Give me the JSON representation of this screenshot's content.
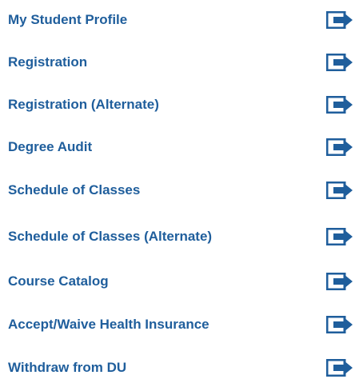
{
  "menu": {
    "items": [
      {
        "label": "My Student Profile",
        "icon": "external-link-icon"
      },
      {
        "label": "Registration",
        "icon": "external-link-icon"
      },
      {
        "label": "Registration (Alternate)",
        "icon": "external-link-icon"
      },
      {
        "label": "Degree Audit",
        "icon": "external-link-icon"
      },
      {
        "label": "Schedule of Classes",
        "icon": "external-link-icon"
      },
      {
        "label": "Schedule of Classes (Alternate)",
        "icon": "external-link-icon"
      },
      {
        "label": "Course Catalog",
        "icon": "external-link-icon"
      },
      {
        "label": "Accept/Waive Health Insurance",
        "icon": "external-link-icon"
      },
      {
        "label": "Withdraw from DU",
        "icon": "external-link-icon"
      }
    ]
  },
  "colors": {
    "link": "#1f5e9c",
    "icon": "#1f5e9c"
  }
}
